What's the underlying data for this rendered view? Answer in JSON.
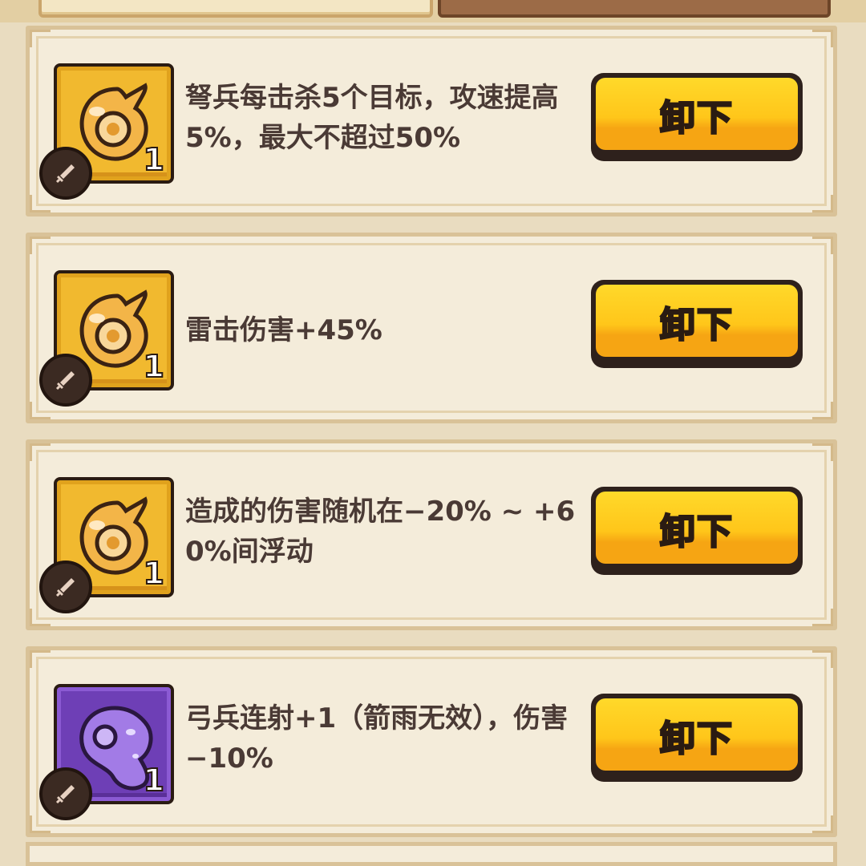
{
  "items": [
    {
      "description": "弩兵每击杀5个目标，攻速提高5%，最大不超过50%",
      "level": "1",
      "rarity": "gold",
      "icon": "gold-spirit-icon",
      "badge_icon": "sword-icon",
      "button_label": "卸下"
    },
    {
      "description": "雷击伤害+45%",
      "level": "1",
      "rarity": "gold",
      "icon": "gold-spirit-icon",
      "badge_icon": "sword-icon",
      "button_label": "卸下"
    },
    {
      "description": "造成的伤害随机在−20% ~ +60%间浮动",
      "level": "1",
      "rarity": "gold",
      "icon": "gold-spirit-icon",
      "badge_icon": "sword-icon",
      "button_label": "卸下"
    },
    {
      "description": "弓兵连射+1（箭雨无效），伤害−10%",
      "level": "1",
      "rarity": "purple",
      "icon": "purple-spirit-icon",
      "badge_icon": "sword-icon",
      "button_label": "卸下"
    }
  ],
  "colors": {
    "gold": "#f1b92f",
    "purple": "#6e3fb6",
    "button": "#ffc61a",
    "text": "#4a3a35"
  }
}
